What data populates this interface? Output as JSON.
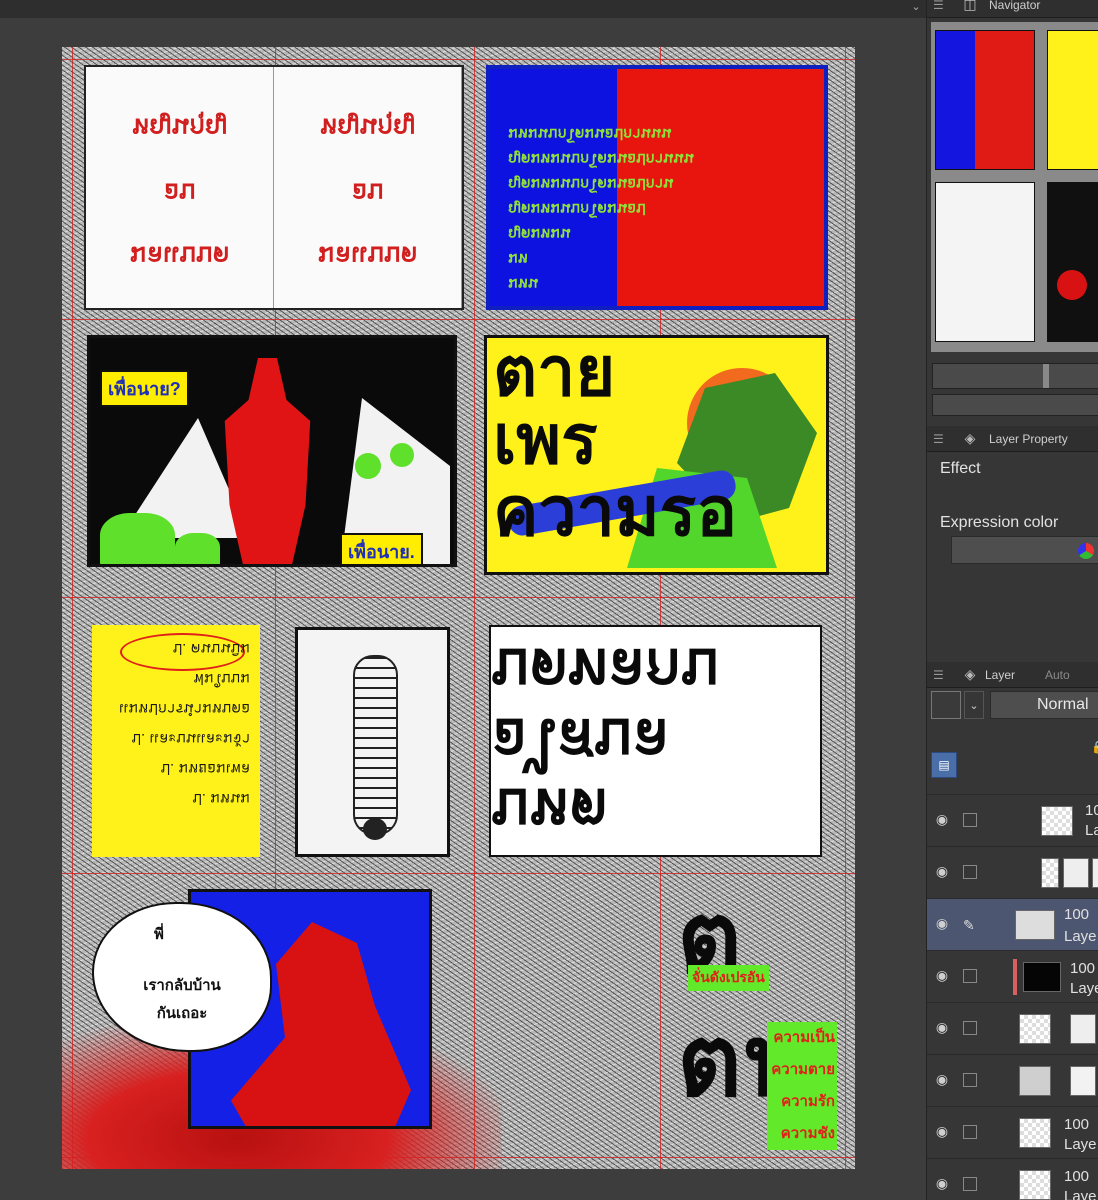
{
  "canvas": {
    "collapse_icon": "chevron-down-icon",
    "book": {
      "left_lines": [
        "หญนกุญ",
        "อบ",
        "มลแบบด"
      ],
      "right_lines": [
        "หญนกุญ",
        "อบ",
        "มลแบบด"
      ]
    },
    "bluered_lines": [
      "มหน",
      "มห",
      "ญดมหมน",
      "ญดมหมนบกโดมนอป",
      "ญดมหมนบกโดมนอปกาน",
      "ญดมหมนบกโดมนอปกานนน",
      "มหมนบกโดมนอปกานนน"
    ],
    "redwoman": {
      "label_top": "เพื่อนาย?",
      "label_bottom": "เพื่อนาย."
    },
    "yellow_big": [
      "ตาย",
      "เพร",
      "ความรอ"
    ],
    "note_lines": [
      "ป. คนบนบิม",
      "ฟมใบบม",
      "แมหปการนำมหบดอ",
      "ป. และบนและมจ้า",
      "ป. มหยอมเพล",
      "ป. มหนม"
    ],
    "white_big": [
      "บดทลกบ",
      "อไสบล",
      "บหต"
    ],
    "bubble": {
      "top": "พี่",
      "line1": "เรากลับบ้าน",
      "line2": "กันเถอะ"
    },
    "end_big": [
      "ต",
      "ตน"
    ],
    "tag_top": "จั่นดังเปรอัน",
    "green_words": [
      "ความเป็น",
      "ความตาย",
      "ความรัก",
      "ความชัง"
    ]
  },
  "side": {
    "navigator": {
      "tab_label": "Navigator",
      "icon": "navigator-icon"
    },
    "layer_property": {
      "tab_label": "Layer Property",
      "icon": "layer-property-icon",
      "effect_label": "Effect",
      "expression_label": "Expression color",
      "color_icon": "color-wheel-icon"
    },
    "layer_panel": {
      "tab_label": "Layer",
      "tab2_label": "Auto",
      "blend_mode": "Normal",
      "rows": [
        {
          "pct": "100",
          "name": "La"
        },
        {
          "pct": "",
          "name": ""
        },
        {
          "pct": "100 ",
          "name": "Laye"
        },
        {
          "pct": "100",
          "name": "Laye"
        },
        {
          "pct": "",
          "name": ""
        },
        {
          "pct": "",
          "name": ""
        },
        {
          "pct": "100 ",
          "name": "Laye"
        },
        {
          "pct": "100 ",
          "name": "Laye"
        }
      ]
    }
  }
}
